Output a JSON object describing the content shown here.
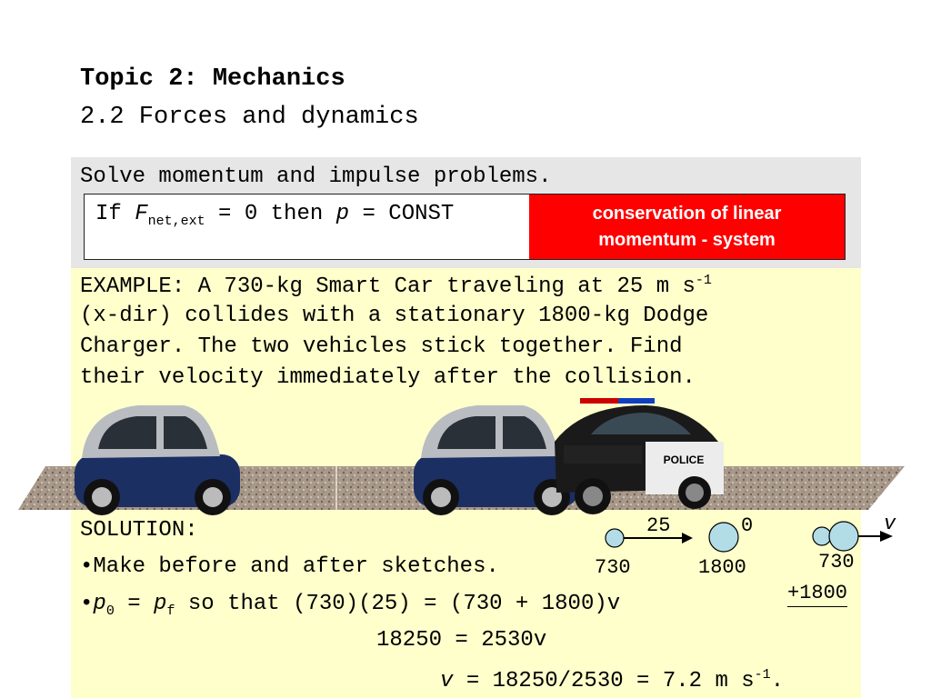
{
  "header": {
    "title": "Topic 2: Mechanics",
    "subtitle": "2.2 Forces and dynamics"
  },
  "objective": "Solve momentum and impulse problems.",
  "rule": {
    "if_word": "If",
    "F": "F",
    "F_subscript": "net,ext",
    "condition": "= 0 then",
    "p": "p",
    "result": "= CONST",
    "label_line1": "conservation of linear",
    "label_line2": "momentum - system",
    "label_color": "#ff0000"
  },
  "example": {
    "line1_a": "EXAMPLE: A 730-kg Smart Car traveling at 25 m s",
    "line1_sup": "-1",
    "line2": "(x-dir) collides with a stationary 1800-kg Dodge",
    "line3": "Charger. The two vehicles stick together. Find",
    "line4": "their velocity immediately after the collision.",
    "police_text": "POLICE"
  },
  "solution": {
    "heading": "SOLUTION:",
    "bullet1": "Make before and after sketches.",
    "bullet2_p0": "p",
    "bullet2_sub0": "0",
    "bullet2_eq": "=",
    "bullet2_pf": "p",
    "bullet2_subf": "f",
    "bullet2_rest": "so that (730)(25) = (730 + 1800)v",
    "line3": "18250 = 2530v",
    "line4_v": "v",
    "line4_rest": "= 18250/2530 = 7.2 m s",
    "line4_sup": "-1",
    "line4_end": "."
  },
  "sketch": {
    "before_velocity_a": "25",
    "before_velocity_b": "0",
    "mass_a": "730",
    "mass_b": "1800",
    "after_velocity": "v",
    "after_mass_top": "730",
    "after_mass_bottom": "+1800",
    "ball_color": "#b3dde6"
  },
  "colors": {
    "grey_panel": "#e6e6e6",
    "yellow_panel": "#ffffcc"
  }
}
